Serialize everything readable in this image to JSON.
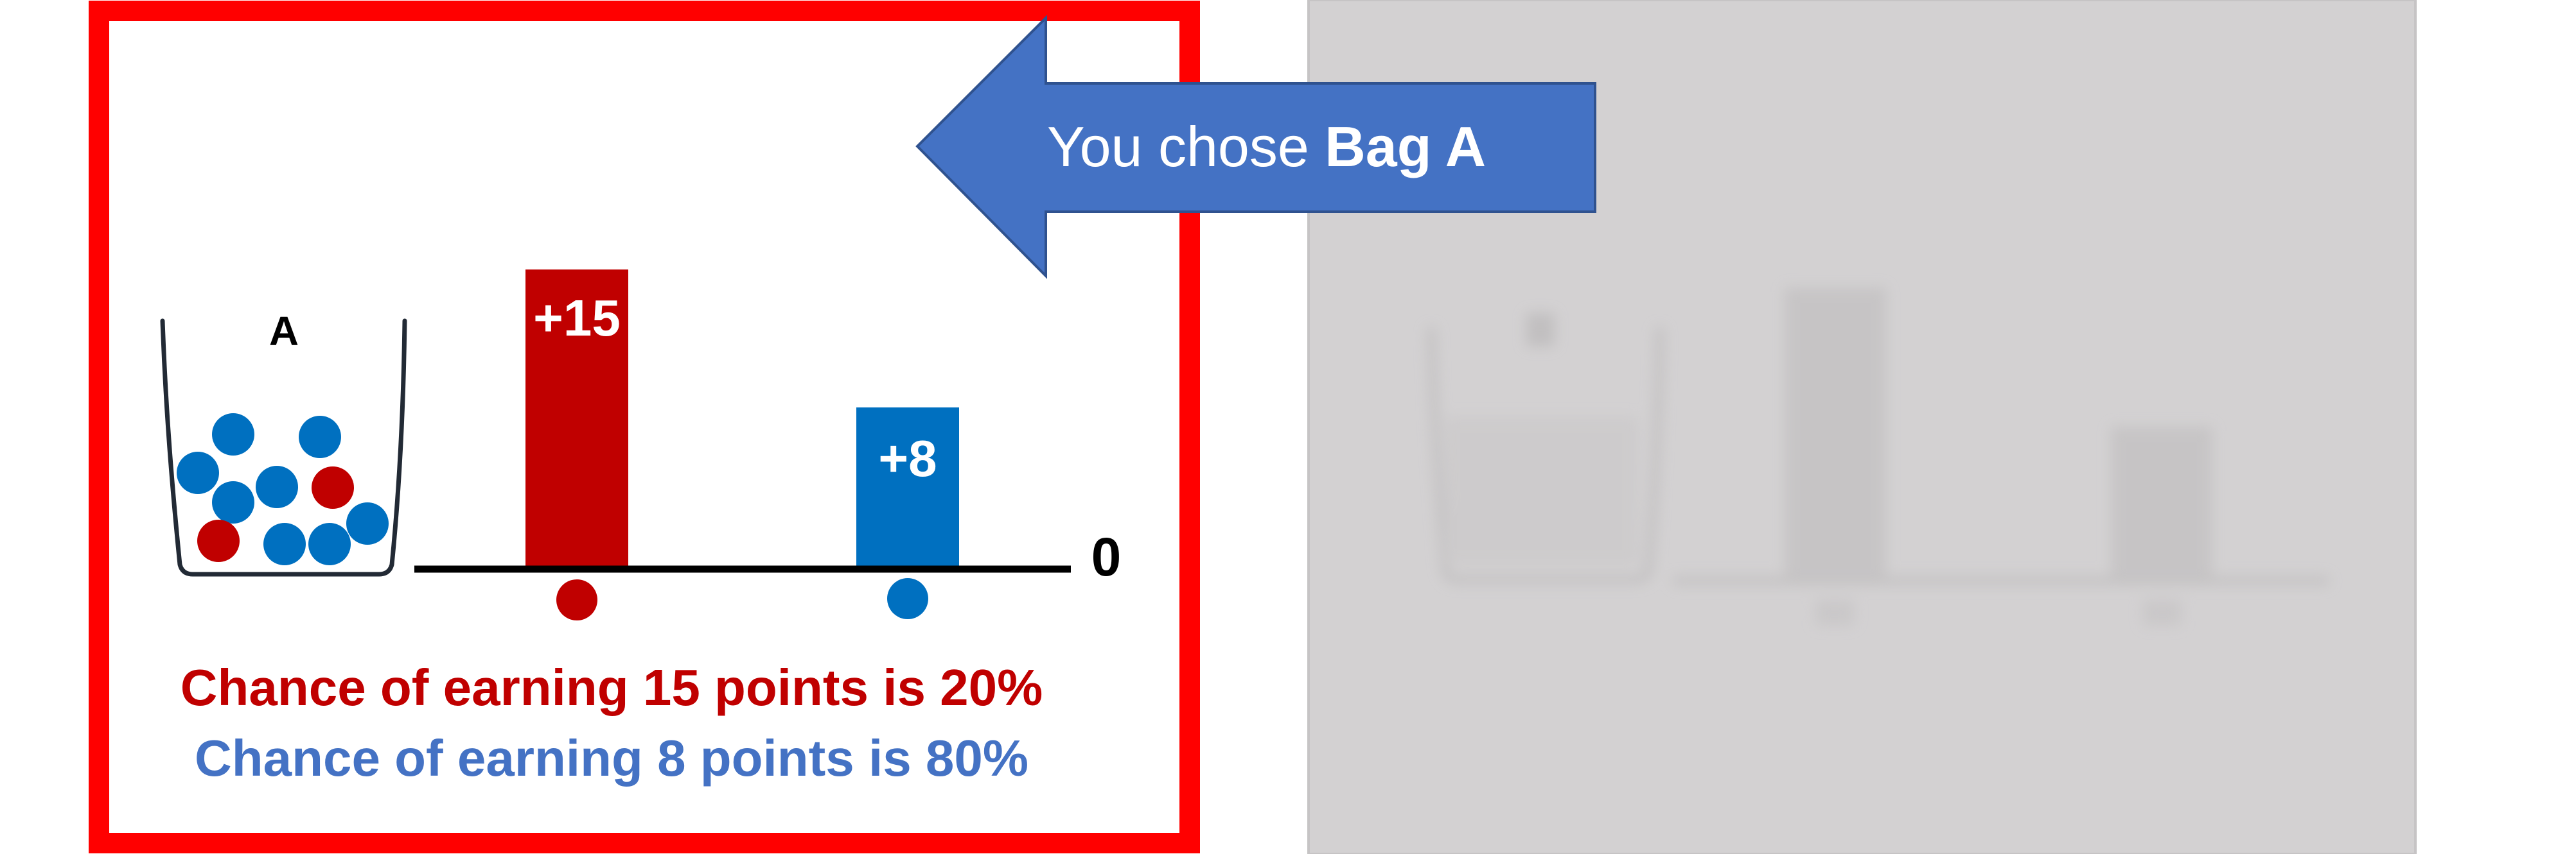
{
  "colors": {
    "highlight_border": "#ff0000",
    "red_ball": "#c00000",
    "blue_ball": "#0070c0",
    "arrow_fill": "#4472c4",
    "red_text": "#c00000",
    "blue_text": "#4472c4",
    "greyed_panel": "#d3d1d2"
  },
  "arrow": {
    "prefix": "You chose ",
    "bag_name": "Bag A"
  },
  "bag_a": {
    "label": "A",
    "red_bar_label": "+15",
    "blue_bar_label": "+8",
    "zero_label": "0",
    "red_text": "Chance of earning 15 points is 20%",
    "blue_text": "Chance of earning 8 points is 80%"
  },
  "bag_b": {
    "state": "greyed-out"
  }
}
